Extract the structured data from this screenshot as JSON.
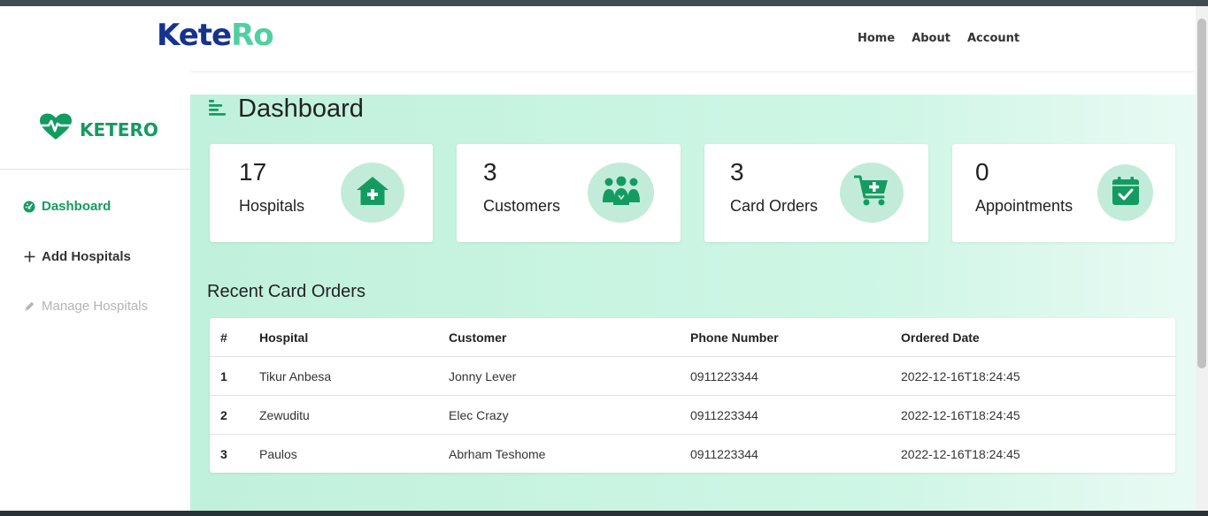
{
  "brand": {
    "logo_part1": "Kete",
    "logo_part2": "Ro",
    "sidebar_name": "KETERO"
  },
  "nav": {
    "links": [
      "Home",
      "About",
      "Account"
    ]
  },
  "sidebar": {
    "items": [
      {
        "label": "Dashboard",
        "icon": "dashboard-gauge-icon",
        "active": true
      },
      {
        "label": "Add Hospitals",
        "icon": "plus-icon",
        "active": false
      },
      {
        "label": "Manage Hospitals",
        "icon": "pencil-icon",
        "disabled": true
      }
    ]
  },
  "page": {
    "title": "Dashboard",
    "title_icon": "menu-align-icon"
  },
  "stats": [
    {
      "value": "17",
      "label": "Hospitals",
      "icon": "hospital-house-icon"
    },
    {
      "value": "3",
      "label": "Customers",
      "icon": "people-group-icon"
    },
    {
      "value": "3",
      "label": "Card Orders",
      "icon": "cart-plus-icon"
    },
    {
      "value": "0",
      "label": "Appointments",
      "icon": "calendar-check-icon"
    }
  ],
  "recent_orders": {
    "title": "Recent Card Orders",
    "columns": [
      "#",
      "Hospital",
      "Customer",
      "Phone Number",
      "Ordered Date"
    ],
    "rows": [
      [
        "1",
        "Tikur Anbesa",
        "Jonny Lever",
        "0911223344",
        "2022-12-16T18:24:45"
      ],
      [
        "2",
        "Zewuditu",
        "Elec Crazy",
        "0911223344",
        "2022-12-16T18:24:45"
      ],
      [
        "3",
        "Paulos",
        "Abrham Teshome",
        "0911223344",
        "2022-12-16T18:24:45"
      ]
    ]
  },
  "colors": {
    "brand_navy": "#16328f",
    "brand_mint": "#4fd0a0",
    "accent_green": "#149b61",
    "icon_circle": "#c2ecd9"
  }
}
